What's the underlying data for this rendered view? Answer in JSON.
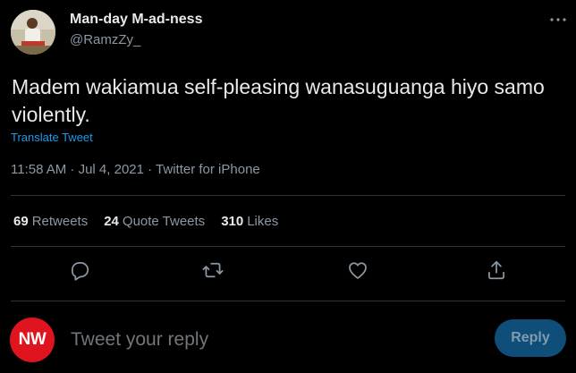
{
  "author": {
    "name": "Man-day M-ad-ness",
    "handle": "@RamzZy_"
  },
  "tweet": {
    "text": "Madem wakiamua self-pleasing wanasuguanga hiyo samo violently.",
    "translate_label": "Translate Tweet",
    "meta": "11:58 AM · Jul 4, 2021 · Twitter for iPhone"
  },
  "stats": [
    {
      "count": "69",
      "label": "Retweets"
    },
    {
      "count": "24",
      "label": "Quote Tweets"
    },
    {
      "count": "310",
      "label": "Likes"
    }
  ],
  "icons": {
    "more": "more-horizontal-icon",
    "reply": "reply-icon",
    "retweet": "retweet-icon",
    "like": "heart-icon",
    "share": "share-icon"
  },
  "reply_box": {
    "avatar_text": "NW",
    "placeholder": "Tweet your reply",
    "button_label": "Reply"
  },
  "colors": {
    "background": "#000000",
    "text": "#e7e9ea",
    "secondary_text": "#8b98a5",
    "link": "#1d9bf0",
    "divider": "#2f3336",
    "reply_button": "#0f4e78",
    "reply_avatar": "#e0141e"
  }
}
